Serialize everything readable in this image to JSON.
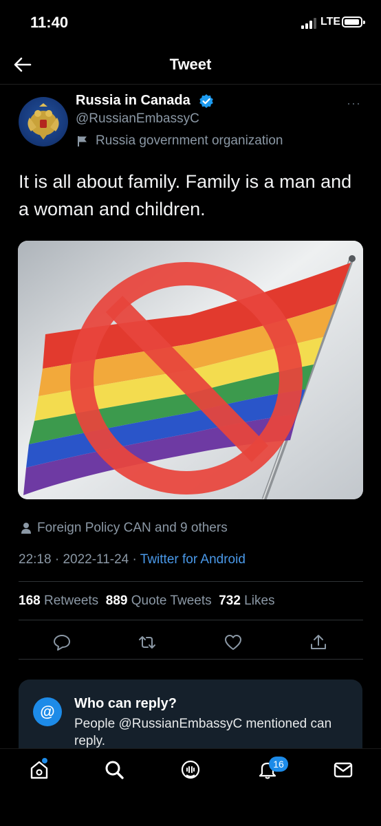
{
  "status_bar": {
    "time": "11:40",
    "network": "LTE",
    "battery_level": 1.0
  },
  "header": {
    "title": "Tweet",
    "back_icon": "arrow-left-icon"
  },
  "author": {
    "name": "Russia in Canada",
    "handle": "@RussianEmbassyC",
    "label": "Russia government organization",
    "verified_icon": "verified-badge-icon",
    "more_label": "···"
  },
  "tweet": {
    "text": "It is all about family. Family is a man and a woman and children.",
    "media_description_icon": "rainbow-flag-prohibited-image"
  },
  "social_context": {
    "likers": "Foreign Policy CAN and 9 others"
  },
  "meta": {
    "time": "22:18",
    "separator": "·",
    "date": "2022-11-24",
    "source": "Twitter for Android"
  },
  "stats": {
    "retweets_count": "168",
    "retweets_label": "Retweets",
    "quotes_count": "889",
    "quotes_label": "Quote Tweets",
    "likes_count": "732",
    "likes_label": "Likes"
  },
  "actions": [
    "reply-icon",
    "retweet-icon",
    "like-icon",
    "share-icon"
  ],
  "reply_restriction": {
    "badge": "@",
    "title": "Who can reply?",
    "body": "People @RussianEmbassyC mentioned can reply."
  },
  "tab_bar": {
    "tabs": [
      "home-icon",
      "search-icon",
      "spaces-icon",
      "notifications-icon",
      "messages-icon"
    ],
    "notifications_count": "16"
  },
  "colors": {
    "accent": "#1d8be8",
    "link": "#4a99e9",
    "muted": "#8b98a5",
    "card": "#15202b"
  }
}
